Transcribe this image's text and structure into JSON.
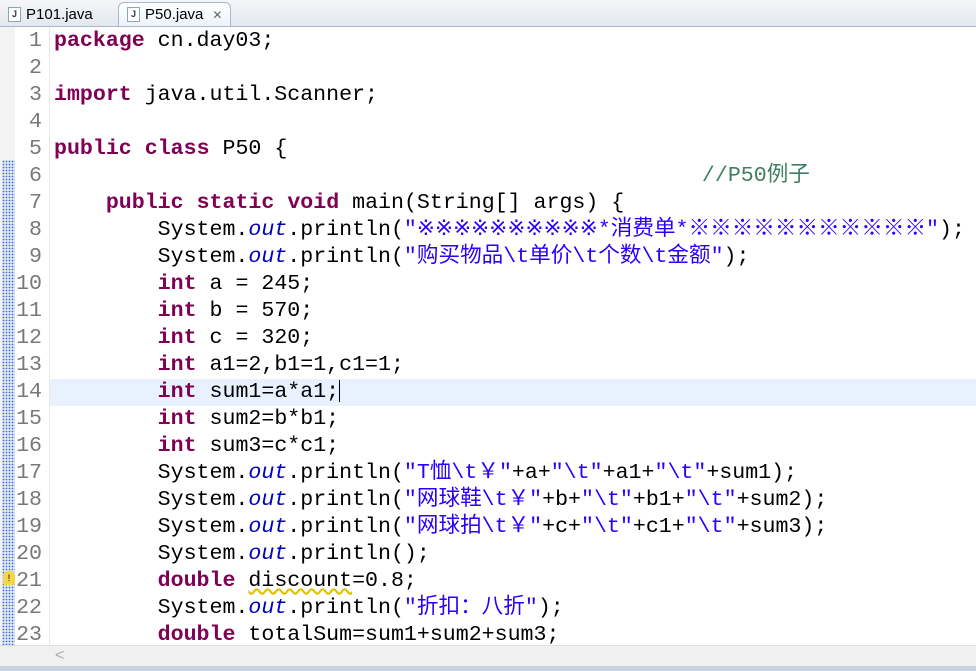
{
  "tabs": [
    {
      "label": "P101.java",
      "active": false
    },
    {
      "label": "P50.java",
      "active": true,
      "close": "✕"
    }
  ],
  "editor": {
    "current_line": 14,
    "warning_line": 21,
    "lines": [
      [
        [
          "kw",
          "package"
        ],
        [
          "p",
          " cn.day03;"
        ]
      ],
      [],
      [
        [
          "kw",
          "import"
        ],
        [
          "p",
          " java.util.Scanner;"
        ]
      ],
      [],
      [
        [
          "kw",
          "public"
        ],
        [
          "p",
          " "
        ],
        [
          "kw",
          "class"
        ],
        [
          "p",
          " P50 {"
        ]
      ],
      [
        [
          "p",
          "                                                  "
        ],
        [
          "cmt",
          "//P50例子"
        ]
      ],
      [
        [
          "p",
          "    "
        ],
        [
          "kw",
          "public"
        ],
        [
          "p",
          " "
        ],
        [
          "kw",
          "static"
        ],
        [
          "p",
          " "
        ],
        [
          "kw",
          "void"
        ],
        [
          "p",
          " main(String[] args) {"
        ]
      ],
      [
        [
          "p",
          "        System."
        ],
        [
          "fld",
          "out"
        ],
        [
          "p",
          ".println("
        ],
        [
          "str",
          "\"※※※※※※※※※※*消费单*※※※※※※※※※※※\""
        ],
        [
          "p",
          ");"
        ]
      ],
      [
        [
          "p",
          "        System."
        ],
        [
          "fld",
          "out"
        ],
        [
          "p",
          ".println("
        ],
        [
          "str",
          "\"购买物品\\t单价\\t个数\\t金额\""
        ],
        [
          "p",
          ");"
        ]
      ],
      [
        [
          "p",
          "        "
        ],
        [
          "kw",
          "int"
        ],
        [
          "p",
          " a = 245;"
        ]
      ],
      [
        [
          "p",
          "        "
        ],
        [
          "kw",
          "int"
        ],
        [
          "p",
          " b = 570;"
        ]
      ],
      [
        [
          "p",
          "        "
        ],
        [
          "kw",
          "int"
        ],
        [
          "p",
          " c = 320;"
        ]
      ],
      [
        [
          "p",
          "        "
        ],
        [
          "kw",
          "int"
        ],
        [
          "p",
          " a1=2,b1=1,c1=1;"
        ]
      ],
      [
        [
          "p",
          "        "
        ],
        [
          "kw",
          "int"
        ],
        [
          "p",
          " sum1=a*a1;"
        ]
      ],
      [
        [
          "p",
          "        "
        ],
        [
          "kw",
          "int"
        ],
        [
          "p",
          " sum2=b*b1;"
        ]
      ],
      [
        [
          "p",
          "        "
        ],
        [
          "kw",
          "int"
        ],
        [
          "p",
          " sum3=c*c1;"
        ]
      ],
      [
        [
          "p",
          "        System."
        ],
        [
          "fld",
          "out"
        ],
        [
          "p",
          ".println("
        ],
        [
          "str",
          "\"T恤\\t￥\""
        ],
        [
          "p",
          "+a+"
        ],
        [
          "str",
          "\"\\t\""
        ],
        [
          "p",
          "+a1+"
        ],
        [
          "str",
          "\"\\t\""
        ],
        [
          "p",
          "+sum1);"
        ]
      ],
      [
        [
          "p",
          "        System."
        ],
        [
          "fld",
          "out"
        ],
        [
          "p",
          ".println("
        ],
        [
          "str",
          "\"网球鞋\\t￥\""
        ],
        [
          "p",
          "+b+"
        ],
        [
          "str",
          "\"\\t\""
        ],
        [
          "p",
          "+b1+"
        ],
        [
          "str",
          "\"\\t\""
        ],
        [
          "p",
          "+sum2);"
        ]
      ],
      [
        [
          "p",
          "        System."
        ],
        [
          "fld",
          "out"
        ],
        [
          "p",
          ".println("
        ],
        [
          "str",
          "\"网球拍\\t￥\""
        ],
        [
          "p",
          "+c+"
        ],
        [
          "str",
          "\"\\t\""
        ],
        [
          "p",
          "+c1+"
        ],
        [
          "str",
          "\"\\t\""
        ],
        [
          "p",
          "+sum3);"
        ]
      ],
      [
        [
          "p",
          "        System."
        ],
        [
          "fld",
          "out"
        ],
        [
          "p",
          ".println();"
        ]
      ],
      [
        [
          "p",
          "        "
        ],
        [
          "kw",
          "double"
        ],
        [
          "p",
          " "
        ],
        [
          "warn",
          "discount"
        ],
        [
          "p",
          "=0.8;"
        ]
      ],
      [
        [
          "p",
          "        System."
        ],
        [
          "fld",
          "out"
        ],
        [
          "p",
          ".println("
        ],
        [
          "str",
          "\"折扣：八折\""
        ],
        [
          "p",
          ");"
        ]
      ],
      [
        [
          "p",
          "        "
        ],
        [
          "kw",
          "double"
        ],
        [
          "p",
          " totalSum=sum1+sum2+sum3;"
        ]
      ]
    ]
  },
  "scrollbar": {
    "left_arrow": "<"
  }
}
